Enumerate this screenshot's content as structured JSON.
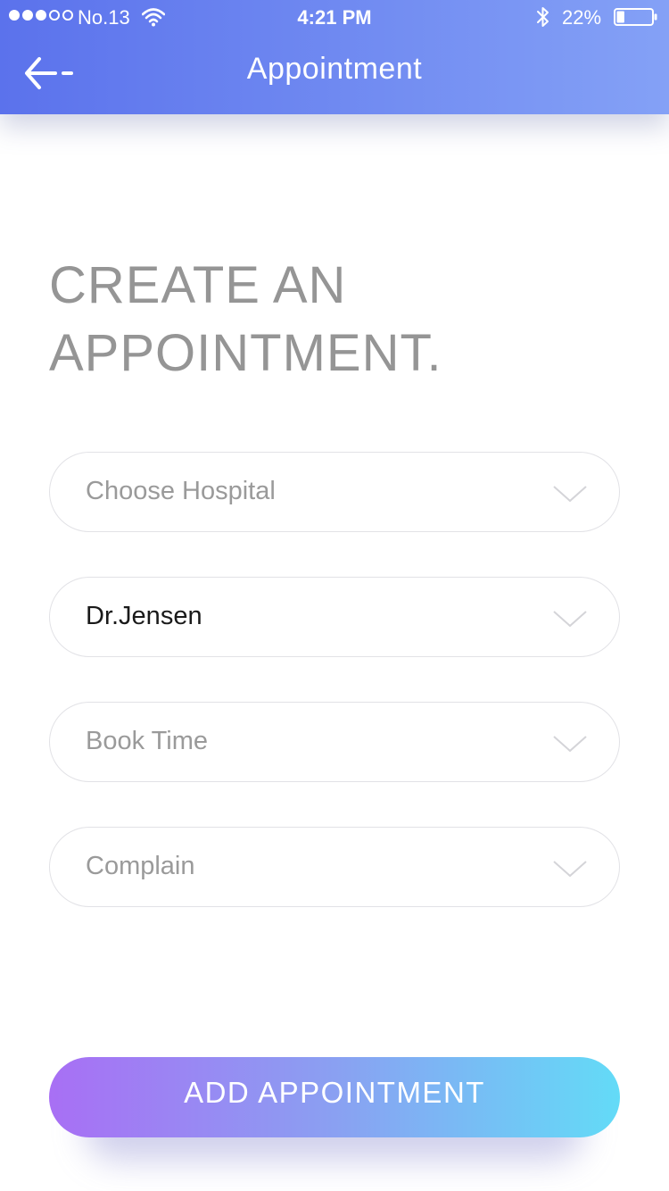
{
  "status_bar": {
    "carrier": "No.13",
    "time": "4:21 PM",
    "battery": "22%",
    "battery_level": 0.22,
    "signal_bars": 3,
    "signal_max": 5,
    "icons": [
      "wifi-icon",
      "bluetooth-icon",
      "battery-icon"
    ]
  },
  "nav": {
    "title": "Appointment",
    "back_icon": "arrow-left-icon"
  },
  "page": {
    "heading_line1": "CREATE AN",
    "heading_line2": "APPOINTMENT."
  },
  "form": {
    "fields": [
      {
        "name": "hospital",
        "text": "Choose Hospital",
        "filled": false,
        "icon": "chevron-down-icon"
      },
      {
        "name": "doctor",
        "text": "Dr.Jensen",
        "filled": true,
        "icon": "chevron-down-icon"
      },
      {
        "name": "time",
        "text": "Book Time",
        "filled": false,
        "icon": "chevron-down-icon"
      },
      {
        "name": "complain",
        "text": "Complain",
        "filled": false,
        "icon": "chevron-down-icon"
      }
    ]
  },
  "actions": {
    "add_label": "ADD APPOINTMENT"
  },
  "colors": {
    "header_start": "#5b72ec",
    "header_end": "#84a1f6",
    "button_start": "#a86ff4",
    "button_end": "#63dbf7",
    "heading_text": "#959595",
    "placeholder_text": "#9a9a9a",
    "filled_text": "#1a1a1a"
  }
}
